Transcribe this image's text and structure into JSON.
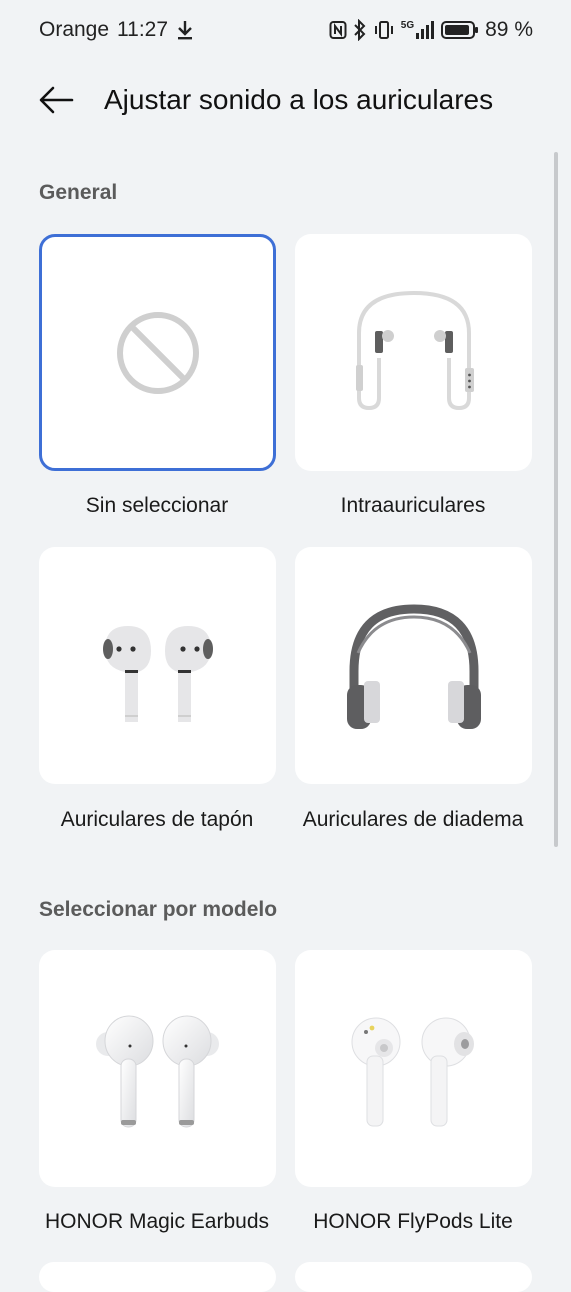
{
  "status_bar": {
    "carrier": "Orange",
    "time": "11:27",
    "network": "5G",
    "battery": "89 %"
  },
  "header": {
    "title": "Ajustar sonido a los auriculares"
  },
  "sections": {
    "general": {
      "title": "General",
      "items": [
        {
          "label": "Sin seleccionar",
          "icon": "none-icon"
        },
        {
          "label": "Intraauriculares",
          "icon": "in-ear-headphones-icon"
        },
        {
          "label": "Auriculares de tapón",
          "icon": "earbuds-icon"
        },
        {
          "label": "Auriculares de diadema",
          "icon": "over-ear-headphones-icon"
        }
      ]
    },
    "by_model": {
      "title": "Seleccionar por modelo",
      "items": [
        {
          "label": "HONOR Magic Earbuds"
        },
        {
          "label": "HONOR FlyPods Lite"
        }
      ]
    }
  },
  "colors": {
    "accent": "#3e6fd6",
    "background": "#f1f3f5",
    "card": "#ffffff"
  }
}
